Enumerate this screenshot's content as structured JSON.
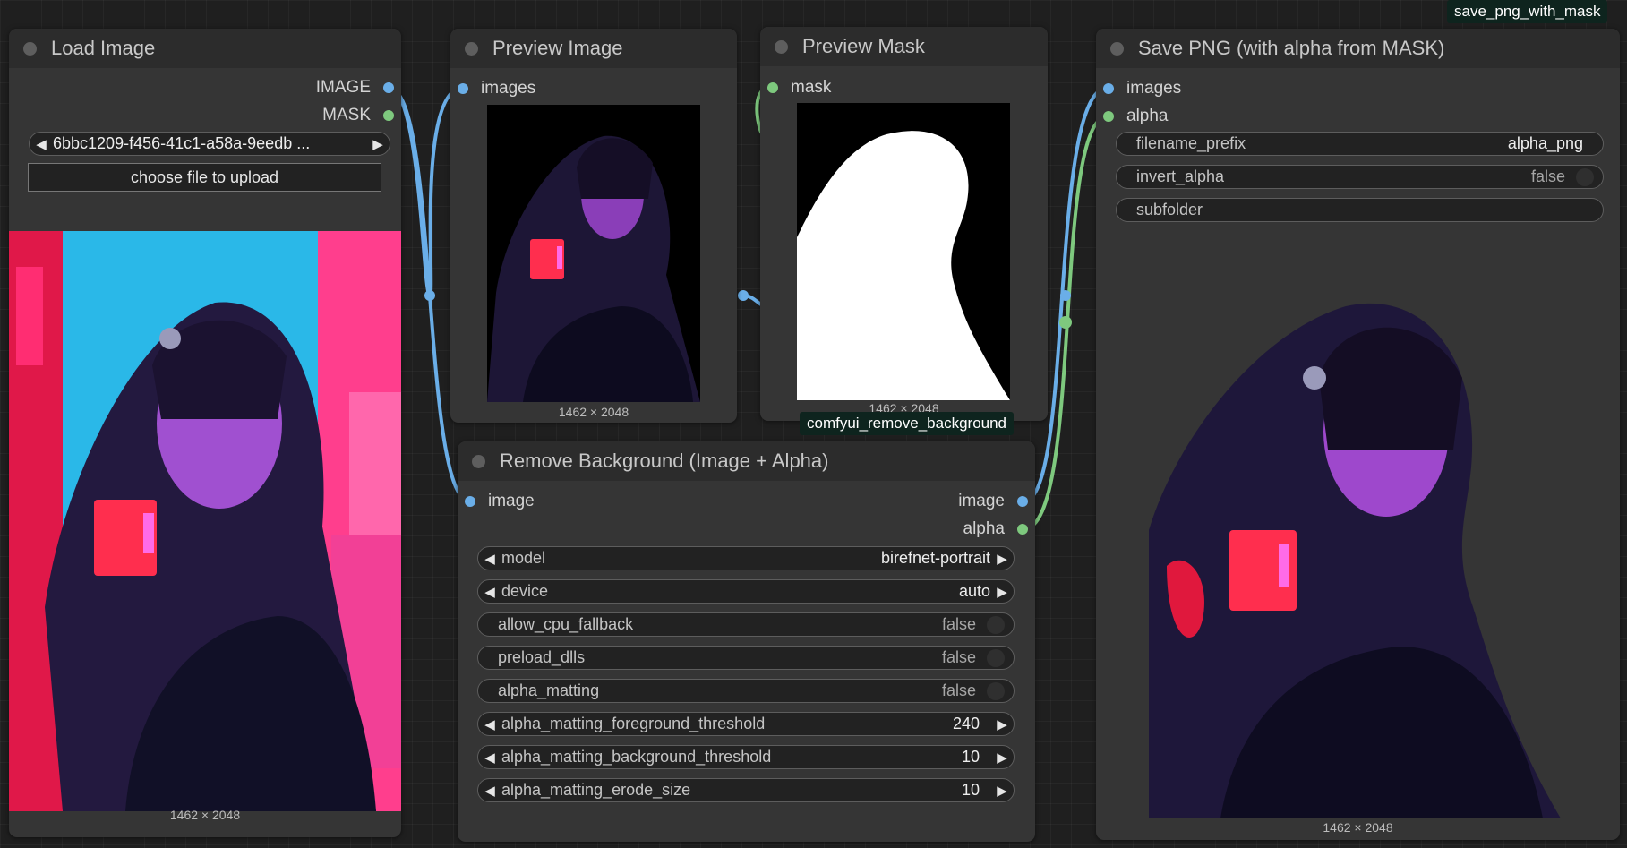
{
  "tags": {
    "save_node_tag": "save_png_with_mask",
    "remove_bg_tag": "comfyui_remove_background"
  },
  "load_image": {
    "title": "Load Image",
    "outputs": {
      "image": "IMAGE",
      "mask": "MASK"
    },
    "file_value": "6bbc1209-f456-41c1-a58a-9eedb ...",
    "upload_label": "choose file to upload",
    "dims": "1462 × 2048"
  },
  "preview_image": {
    "title": "Preview Image",
    "input": "images",
    "dims": "1462 × 2048"
  },
  "preview_mask": {
    "title": "Preview Mask",
    "input": "mask",
    "dims": "1462 × 2048"
  },
  "remove_bg": {
    "title": "Remove Background (Image + Alpha)",
    "input": "image",
    "outputs": {
      "image": "image",
      "alpha": "alpha"
    },
    "widgets": {
      "model": {
        "label": "model",
        "value": "birefnet-portrait"
      },
      "device": {
        "label": "device",
        "value": "auto"
      },
      "allow_cpu_fallback": {
        "label": "allow_cpu_fallback",
        "value": "false"
      },
      "preload_dlls": {
        "label": "preload_dlls",
        "value": "false"
      },
      "alpha_matting": {
        "label": "alpha_matting",
        "value": "false"
      },
      "fg_threshold": {
        "label": "alpha_matting_foreground_threshold",
        "value": "240"
      },
      "bg_threshold": {
        "label": "alpha_matting_background_threshold",
        "value": "10"
      },
      "erode_size": {
        "label": "alpha_matting_erode_size",
        "value": "10"
      }
    }
  },
  "save_png": {
    "title": "Save PNG (with alpha from MASK)",
    "inputs": {
      "images": "images",
      "alpha": "alpha"
    },
    "widgets": {
      "filename_prefix": {
        "label": "filename_prefix",
        "value": "alpha_png"
      },
      "invert_alpha": {
        "label": "invert_alpha",
        "value": "false"
      },
      "subfolder": {
        "label": "subfolder"
      }
    },
    "dims": "1462 × 2048"
  },
  "colors": {
    "image_port": "#6aaee8",
    "mask_port": "#7ec97e",
    "tag_bg": "#0e241e"
  }
}
